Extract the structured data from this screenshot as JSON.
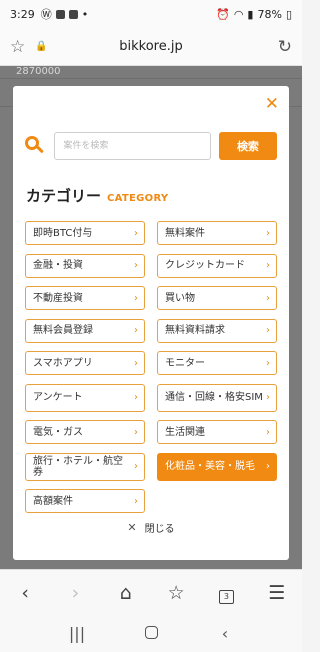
{
  "status_bar": {
    "time": "3:29",
    "battery": "78%",
    "icons": [
      "wordpress-icon",
      "image-icon",
      "folder-icon",
      "dot-icon",
      "alarm-icon",
      "wifi-icon",
      "signal-icon",
      "battery-icon"
    ]
  },
  "browser": {
    "url": "bikkore.jp",
    "tab_count": "3"
  },
  "page_background": {
    "chart_number": "2870000"
  },
  "modal": {
    "search": {
      "placeholder": "案件を検索",
      "value": "",
      "button_label": "検索"
    },
    "heading": {
      "jp": "カテゴリー",
      "en": "CATEGORY"
    },
    "categories": [
      {
        "label": "即時BTC付与",
        "active": false
      },
      {
        "label": "無料案件",
        "active": false
      },
      {
        "label": "金融・投資",
        "active": false
      },
      {
        "label": "クレジットカード",
        "active": false
      },
      {
        "label": "不動産投資",
        "active": false
      },
      {
        "label": "買い物",
        "active": false
      },
      {
        "label": "無料会員登録",
        "active": false
      },
      {
        "label": "無料資料請求",
        "active": false
      },
      {
        "label": "スマホアプリ",
        "active": false
      },
      {
        "label": "モニター",
        "active": false
      },
      {
        "label": "アンケート",
        "active": false
      },
      {
        "label": "通信・回線・格安SIM",
        "active": false
      },
      {
        "label": "電気・ガス",
        "active": false
      },
      {
        "label": "生活関連",
        "active": false
      },
      {
        "label": "旅行・ホテル・航空券",
        "active": false
      },
      {
        "label": "化粧品・美容・脱毛",
        "active": true
      },
      {
        "label": "高額案件",
        "active": false
      }
    ],
    "close_label": "閉じる"
  },
  "colors": {
    "accent": "#f08a12",
    "border": "#e8a13e"
  }
}
